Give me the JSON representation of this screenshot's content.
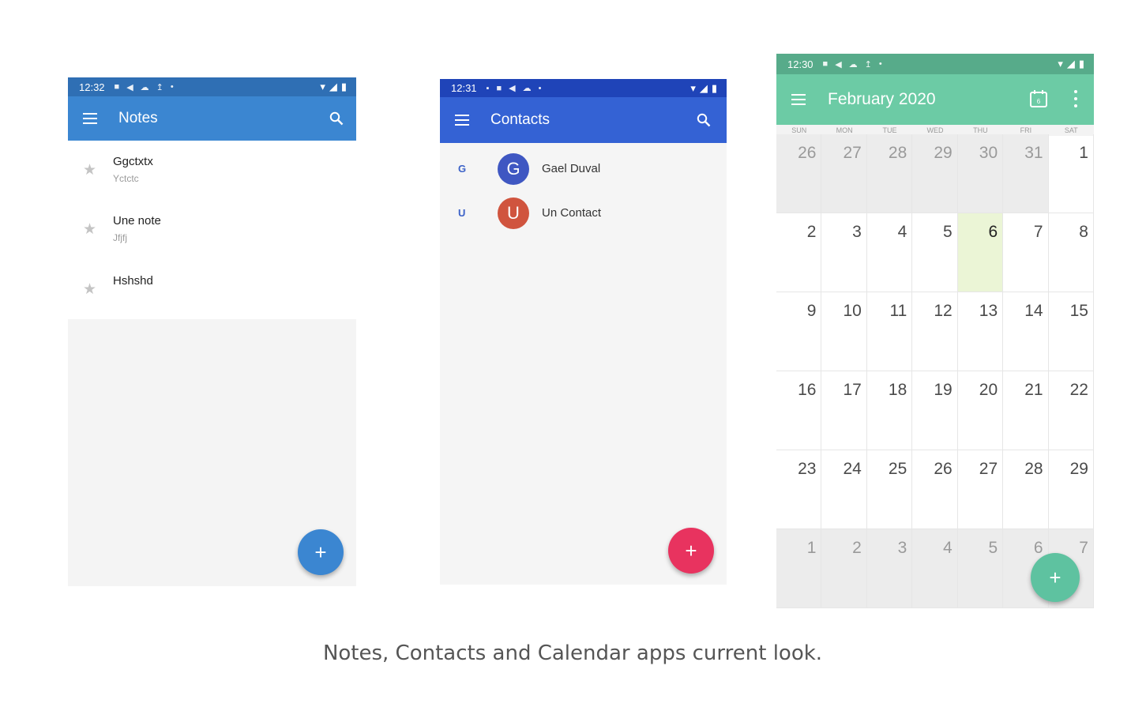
{
  "notes_app": {
    "status_time": "12:32",
    "title": "Notes",
    "notes": [
      {
        "title": "Ggctxtx",
        "subtitle": "Yctctc"
      },
      {
        "title": "Une note",
        "subtitle": "Jfjfj"
      },
      {
        "title": "Hshshd",
        "subtitle": ""
      }
    ],
    "fab_label": "+",
    "colors": {
      "status": "#2f6fb4",
      "appbar": "#3b86d1",
      "fab": "#3b86d1"
    }
  },
  "contacts_app": {
    "status_time": "12:31",
    "title": "Contacts",
    "contacts": [
      {
        "section": "G",
        "initial": "G",
        "name": "Gael Duval",
        "color": "#3f57c2"
      },
      {
        "section": "U",
        "initial": "U",
        "name": "Un Contact",
        "color": "#d0543e"
      }
    ],
    "fab_label": "+",
    "colors": {
      "status": "#1f44b8",
      "appbar": "#3462d4",
      "fab": "#e8335f"
    }
  },
  "calendar_app": {
    "status_time": "12:30",
    "title": "February 2020",
    "calendar_icon_label": "6",
    "weekdays": [
      "SUN",
      "MON",
      "TUE",
      "WED",
      "THU",
      "FRI",
      "SAT"
    ],
    "weeks": [
      [
        "26",
        "27",
        "28",
        "29",
        "30",
        "31",
        "1"
      ],
      [
        "2",
        "3",
        "4",
        "5",
        "6",
        "7",
        "8"
      ],
      [
        "9",
        "10",
        "11",
        "12",
        "13",
        "14",
        "15"
      ],
      [
        "16",
        "17",
        "18",
        "19",
        "20",
        "21",
        "22"
      ],
      [
        "23",
        "24",
        "25",
        "26",
        "27",
        "28",
        "29"
      ],
      [
        "1",
        "2",
        "3",
        "4",
        "5",
        "6",
        "7"
      ]
    ],
    "today": "6",
    "fab_label": "+",
    "colors": {
      "status": "#57ab8a",
      "appbar": "#6ccba5",
      "fab": "#5ec2a0",
      "today_bg": "#ebf5d6"
    }
  },
  "caption": "Notes, Contacts and Calendar apps current look."
}
